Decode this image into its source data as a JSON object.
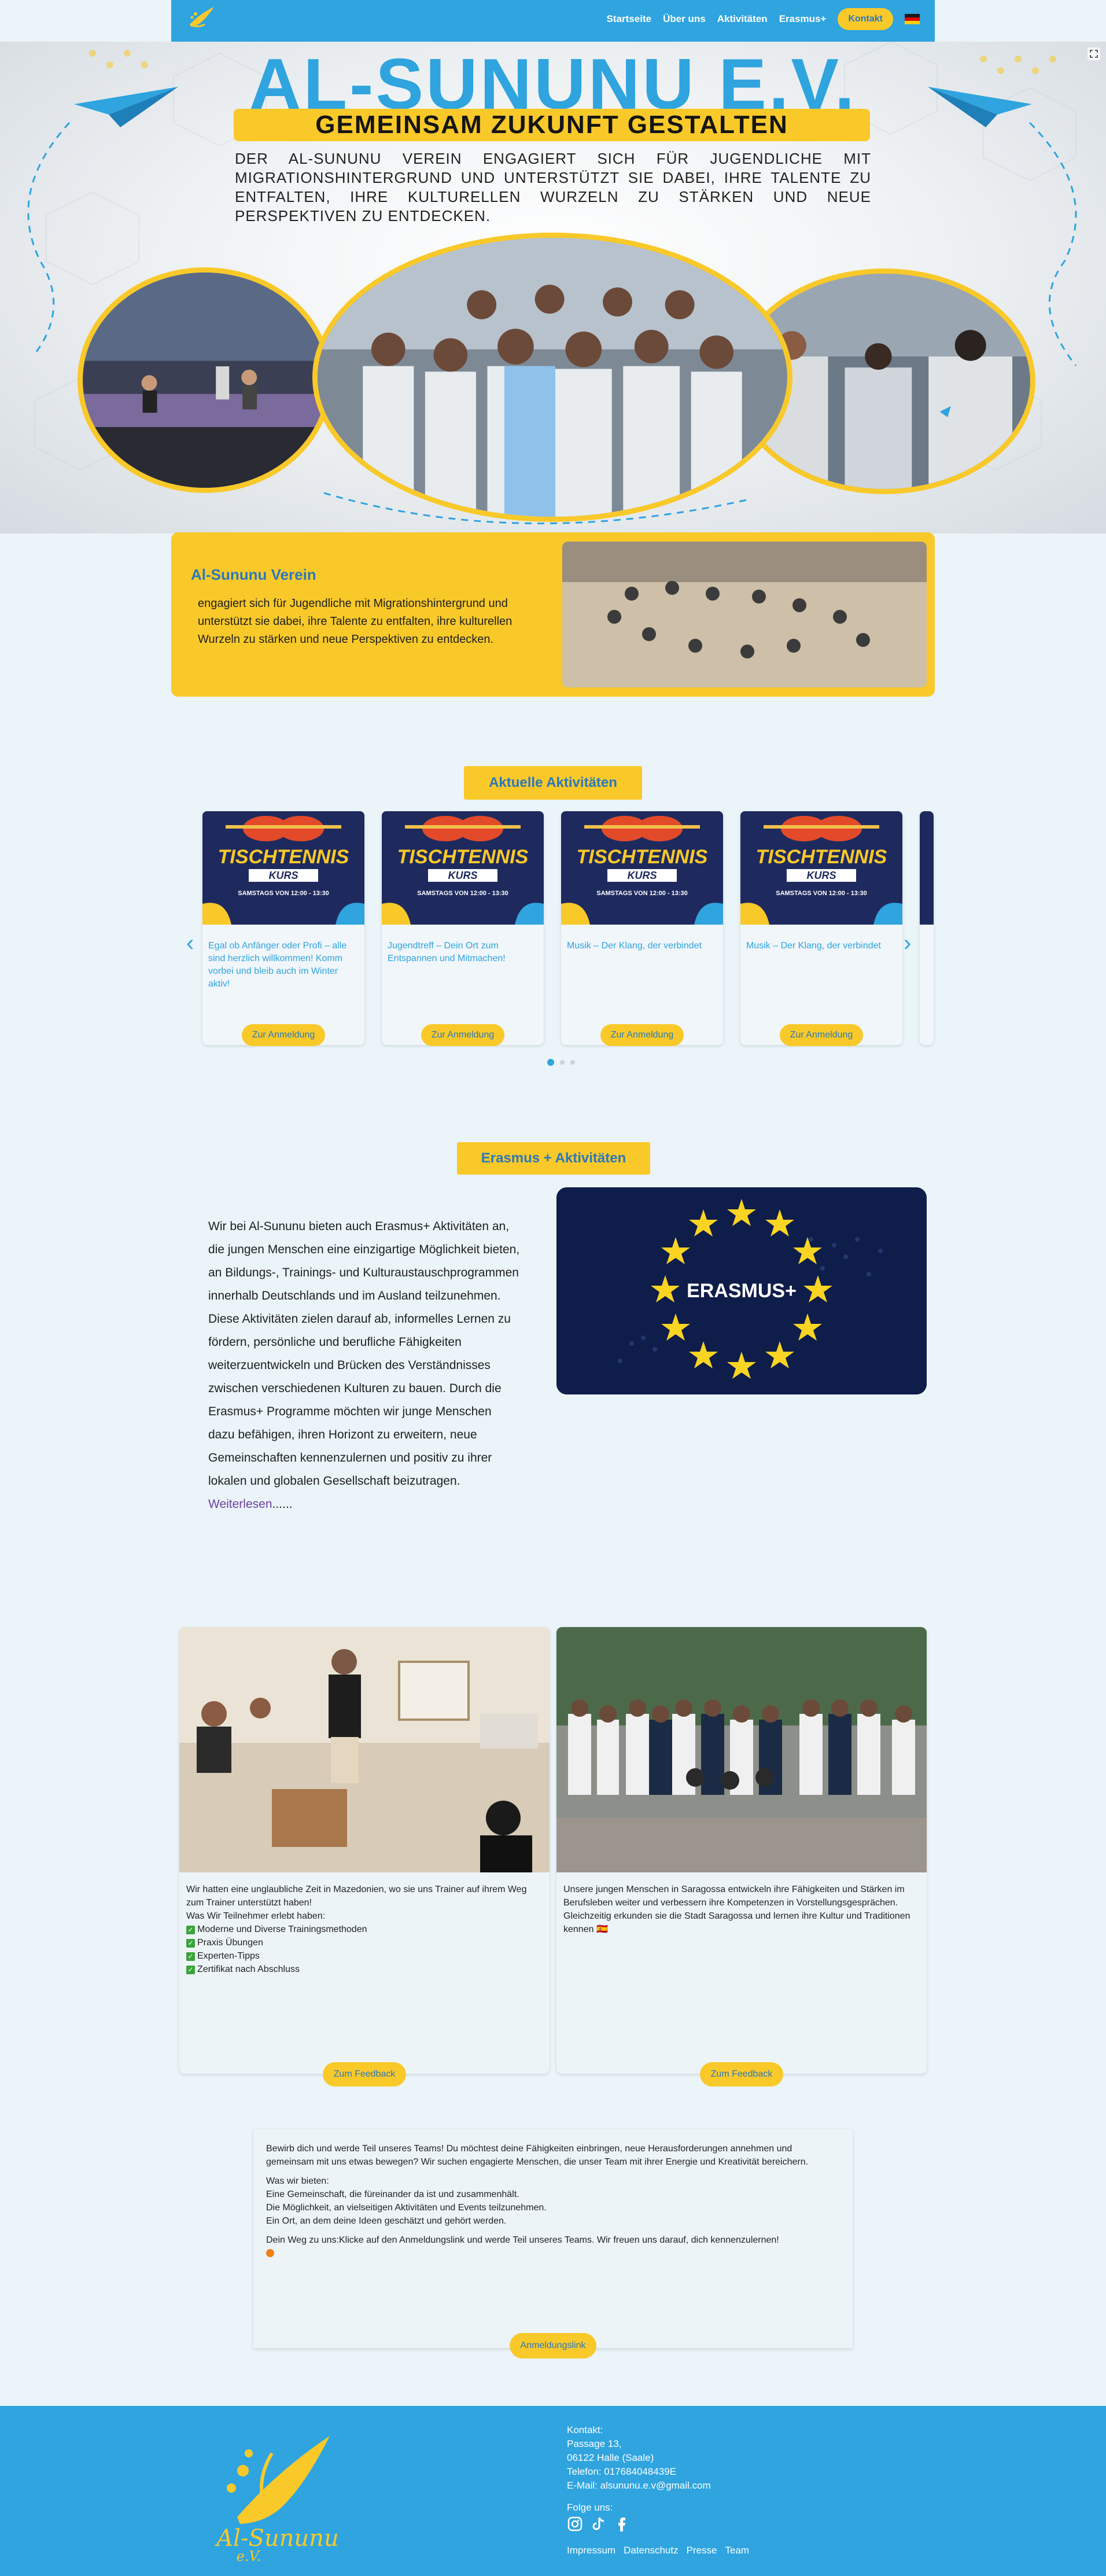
{
  "nav": {
    "logo_text": "Al-Sununu",
    "links": [
      "Startseite",
      "Über uns",
      "Aktivitäten",
      "Erasmus+"
    ],
    "kontakt": "Kontakt"
  },
  "hero": {
    "title": "AL-SUNUNU E.V.",
    "slogan": "GEMEINSAM ZUKUNFT GESTALTEN",
    "text": "Der Al-Sununu Verein engagiert sich für Jugendliche mit Migrationshintergrund und unterstützt sie dabei, ihre Talente zu entfalten, ihre kulturellen Wurzeln zu stärken und neue Perspektiven zu entdecken."
  },
  "intro": {
    "title": "Al-Sununu Verein",
    "text": "engagiert sich für Jugendliche mit Migrationshintergrund und unterstützt sie dabei, ihre Talente zu entfalten, ihre kulturellen Wurzeln zu stärken und neue Perspektiven zu entdecken."
  },
  "activities": {
    "title": "Aktuelle Aktivitäten",
    "poster_title": "TISCHTENNIS",
    "poster_sub": "KURS",
    "poster_time": "SAMSTAGS VON 12:00 - 13:30",
    "cards": [
      {
        "text": "Egal ob Anfänger oder Profi – alle sind herzlich willkommen! Komm vorbei und bleib auch im Winter aktiv!",
        "button": "Zur Anmeldung"
      },
      {
        "text": "Jugendtreff – Dein Ort zum Entspannen und Mitmachen!",
        "button": "Zur Anmeldung"
      },
      {
        "text": "Musik – Der Klang, der verbindet",
        "button": "Zur Anmeldung"
      },
      {
        "text": "Musik – Der Klang, der verbindet",
        "button": "Zur Anmeldung"
      }
    ]
  },
  "erasmus": {
    "title": "Erasmus + Aktivitäten",
    "text": "Wir bei Al-Sununu bieten auch Erasmus+ Aktivitäten an, die jungen Menschen eine einzigartige Möglichkeit bieten, an Bildungs-, Trainings- und Kulturaustauschprogrammen innerhalb Deutschlands und im Ausland teilzunehmen. Diese Aktivitäten zielen darauf ab, informelles Lernen zu fördern, persönliche und berufliche Fähigkeiten weiterzuentwickeln und Brücken des Verständnisses zwischen verschiedenen Kulturen zu bauen. Durch die Erasmus+ Programme möchten wir junge Menschen dazu befähigen, ihren Horizont zu erweitern, neue Gemeinschaften kennenzulernen und positiv zu ihrer lokalen und globalen Gesellschaft beizutragen.",
    "more": "Weiterlesen",
    "more_dots": "......",
    "logo_text": "ERASMUS+"
  },
  "feedback": [
    {
      "intro": "Wir hatten eine unglaubliche Zeit in Mazedonien, wo sie uns Trainer auf ihrem Weg zum Trainer unterstützt haben!",
      "lead": "Was Wir Teilnehmer erlebt haben:",
      "items": [
        "Moderne und Diverse Trainingsmethoden",
        "Praxis Übungen",
        "Experten-Tipps",
        "Zertifikat nach Abschluss"
      ],
      "button": "Zum Feedback"
    },
    {
      "intro": "Unsere jungen Menschen in Saragossa entwickeln ihre Fähigkeiten und Stärken im Berufsleben weiter und verbessern ihre Kompetenzen in Vorstellungsgesprächen. Gleichzeitig erkunden sie die Stadt Saragossa und lernen ihre Kultur und Traditionen kennen 🇪🇸",
      "button": "Zum Feedback"
    }
  ],
  "join": {
    "p1": "Bewirb dich und werde Teil unseres Teams! Du möchtest deine Fähigkeiten einbringen, neue Herausforderungen annehmen und gemeinsam mit uns etwas bewegen? Wir suchen engagierte Menschen, die unser Team mit ihrer Energie und Kreativität bereichern.",
    "lead": "Was wir bieten:",
    "l1": "Eine Gemeinschaft, die füreinander da ist und zusammenhält.",
    "l2": "Die Möglichkeit, an vielseitigen Aktivitäten und Events teilzunehmen.",
    "l3": "Ein Ort, an dem deine Ideen geschätzt und gehört werden.",
    "p3": "Dein Weg zu uns:Klicke auf den Anmeldungslink und werde Teil unseres Teams. Wir freuen uns darauf, dich kennenzulernen!",
    "button": "Anmeldungslink"
  },
  "footer": {
    "logo_text": "Al-Sununu",
    "logo_sub": "e.V.",
    "kontakt_label": "Kontakt:",
    "address1": "Passage 13,",
    "address2": "06122 Halle (Saale)",
    "phone": "Telefon: 017684048439E",
    "email": "E-Mail: alsununu.e.v@gmail.com",
    "follow": "Folge uns:",
    "links": [
      "Impressum",
      "Datenschutz",
      "Presse",
      "Team"
    ]
  },
  "colors": {
    "blue": "#2fa4df",
    "yellow": "#f9c92a",
    "text_blue": "#2c78b9",
    "navy": "#0f1d4a"
  }
}
